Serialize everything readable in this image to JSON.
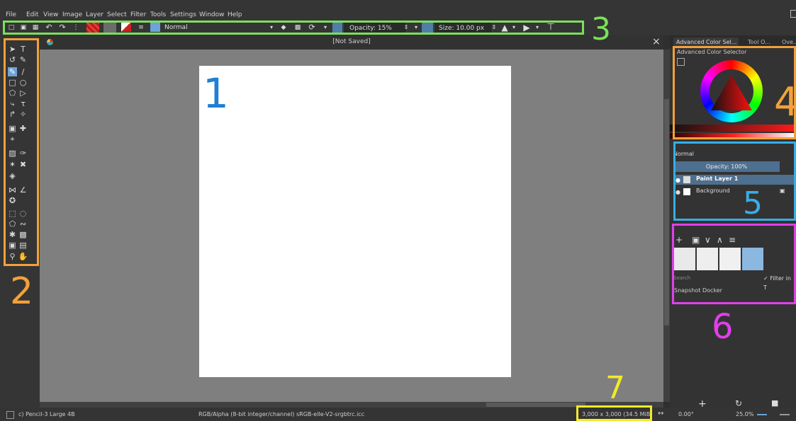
{
  "menu": [
    "File",
    "Edit",
    "View",
    "Image",
    "Layer",
    "Select",
    "Filter",
    "Tools",
    "Settings",
    "Window",
    "Help"
  ],
  "toolbar": {
    "blend_mode": "Normal",
    "opacity": "Opacity: 15%",
    "size": "Size: 10.00 px"
  },
  "document": {
    "title": "[Not Saved]"
  },
  "docker": {
    "tabs": [
      "Advanced Color Sel...",
      "Tool O...",
      "Ove..."
    ],
    "color_selector_title": "Advanced Color Selector",
    "layers": {
      "blend_mode": "Normal",
      "opacity": "Opacity: 100%",
      "items": [
        "Paint Layer 1",
        "Background"
      ]
    },
    "presets": {
      "search_placeholder": "Search",
      "filter_label": "Filter in T",
      "snapshot_title": "Snapshot Docker"
    },
    "bottom": {
      "rotation": "0.00°",
      "zoom": "25.0%"
    }
  },
  "status": {
    "brush": "c) Pencil-3 Large 4B",
    "color_profile": "RGB/Alpha (8-bit integer/channel)  sRGB-elle-V2-srgbtrc.icc",
    "image_size": "3,000 x 3,000 (34.5 MiB)"
  },
  "annotations": [
    "1",
    "2",
    "3",
    "4",
    "5",
    "6",
    "7"
  ],
  "colors": {
    "annot_blue": "#1f7fd0",
    "annot_orange": "#f2a13a",
    "annot_green": "#7ae05a",
    "annot_light_blue": "#36aee8",
    "annot_magenta": "#e040e8",
    "annot_yellow": "#f2ea2a"
  }
}
